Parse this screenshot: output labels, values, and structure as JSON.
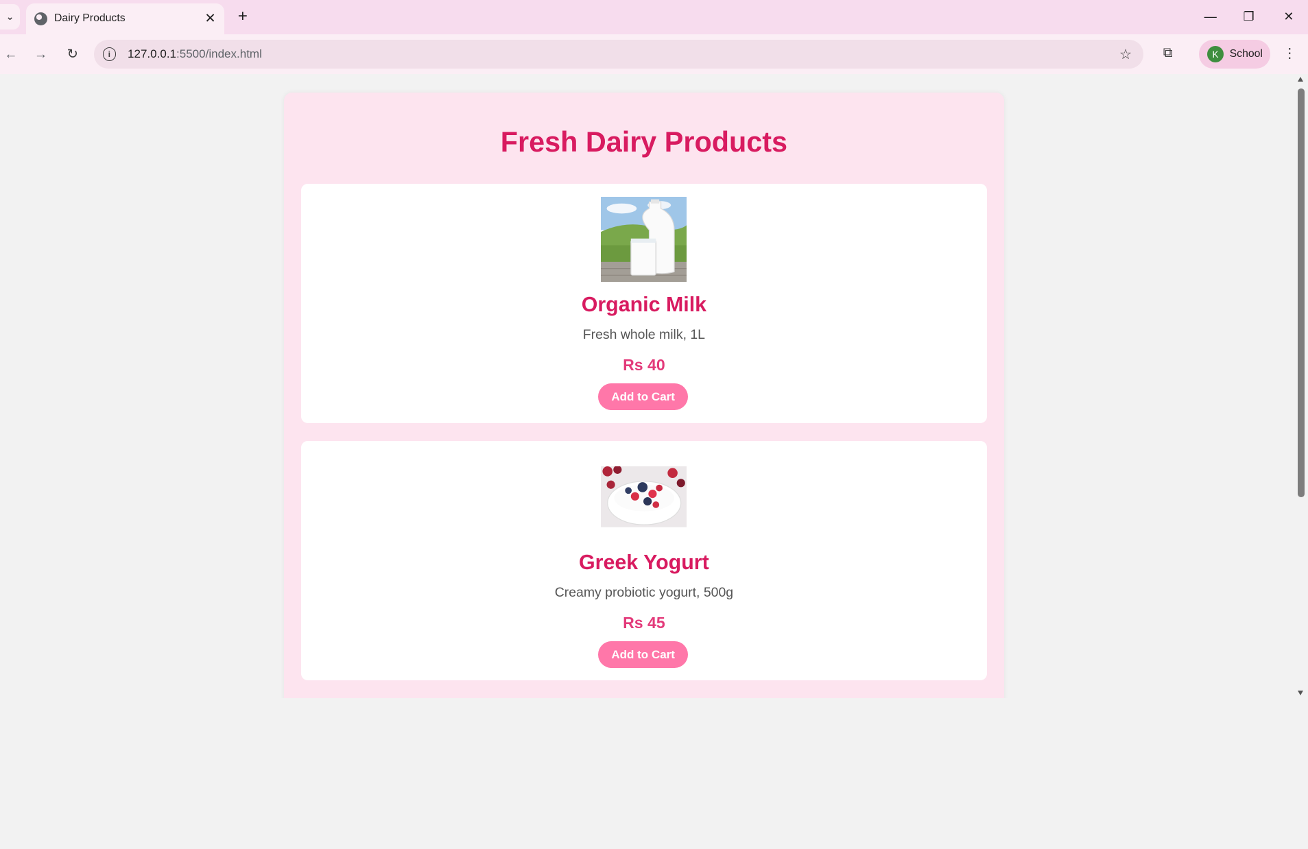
{
  "browser": {
    "tab_title": "Dairy Products",
    "url_host": "127.0.0.1",
    "url_rest": ":5500/index.html",
    "profile_initial": "K",
    "profile_name": "School"
  },
  "page": {
    "title": "Fresh Dairy Products",
    "products": [
      {
        "name": "Organic Milk",
        "description": "Fresh whole milk, 1L",
        "price": "Rs 40",
        "button_label": "Add to Cart"
      },
      {
        "name": "Greek Yogurt",
        "description": "Creamy probiotic yogurt, 500g",
        "price": "Rs 45",
        "button_label": "Add to Cart"
      }
    ]
  },
  "colors": {
    "accent": "#d81b60",
    "price": "#e33a7a",
    "button": "#ff77a9",
    "container_bg": "#fde4ef"
  }
}
